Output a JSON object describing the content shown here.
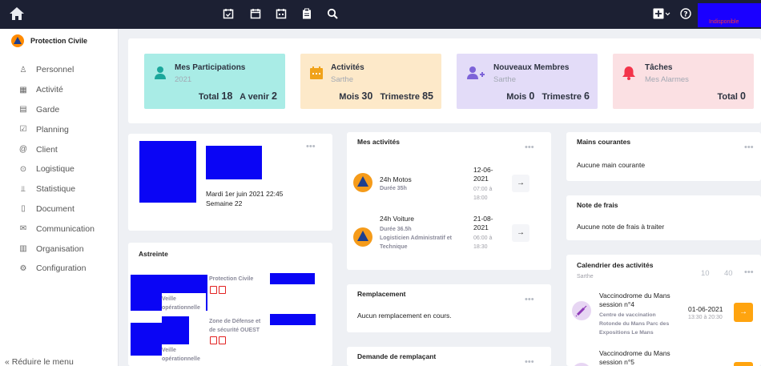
{
  "topbar": {
    "status_text": "Indisponible",
    "icons": [
      "home-icon",
      "calendar-check-icon",
      "calendar-blank-icon",
      "calendar-days-icon",
      "clipboard-icon",
      "search-icon",
      "add-square-icon",
      "help-circle-icon"
    ],
    "colors": {
      "bar": "#1c2033",
      "highlight": "#1a00ff",
      "status": "#ff3535"
    }
  },
  "sidebar": {
    "brand": "Protection Civile",
    "items": [
      {
        "label": "Personnel",
        "icon": "person-icon"
      },
      {
        "label": "Activité",
        "icon": "calendar-icon"
      },
      {
        "label": "Garde",
        "icon": "clipboard-icon"
      },
      {
        "label": "Planning",
        "icon": "calendar-check-icon"
      },
      {
        "label": "Client",
        "icon": "at-icon"
      },
      {
        "label": "Logistique",
        "icon": "target-icon"
      },
      {
        "label": "Statistique",
        "icon": "chart-icon"
      },
      {
        "label": "Document",
        "icon": "file-icon"
      },
      {
        "label": "Communication",
        "icon": "mail-icon"
      },
      {
        "label": "Organisation",
        "icon": "building-icon"
      },
      {
        "label": "Configuration",
        "icon": "gear-icon"
      }
    ],
    "collapse_label": "« Réduire le menu"
  },
  "stats": [
    {
      "title": "Mes Participations",
      "sub": "2021",
      "v1_label": "Total",
      "v1": "18",
      "v2_label": "A venir",
      "v2": "2",
      "bg": "#a9ece6",
      "icon": "user-icon",
      "icon_color": "#1ba79b"
    },
    {
      "title": "Activités",
      "sub": "Sarthe",
      "v1_label": "Mois",
      "v1": "30",
      "v2_label": "Trimestre",
      "v2": "85",
      "bg": "#fde9c9",
      "icon": "calendar-icon",
      "icon_color": "#f0a21a"
    },
    {
      "title": "Nouveaux Membres",
      "sub": "Sarthe",
      "v1_label": "Mois",
      "v1": "0",
      "v2_label": "Trimestre",
      "v2": "6",
      "bg": "#e3dcf8",
      "icon": "user-plus-icon",
      "icon_color": "#7d63d8"
    },
    {
      "title": "Tâches",
      "sub": "Mes Alarmes",
      "v1_label": "Total",
      "v1": "0",
      "v2_label": "",
      "v2": "",
      "bg": "#fbe0e3",
      "icon": "bell-icon",
      "icon_color": "#f3344a"
    }
  ],
  "profile": {
    "date": "Mardi 1er juin 2021 22:45",
    "week": "Semaine 22"
  },
  "astreinte": {
    "title": "Astreinte",
    "entries": [
      {
        "org": "Protection Civile",
        "role": "Veille",
        "role2": "opérationnelle"
      },
      {
        "org": "Zone de Défense et",
        "org2": "de sécurité OUEST",
        "role": "Veille",
        "role2": "opérationnelle"
      }
    ]
  },
  "mes_activites": {
    "title": "Mes activités",
    "items": [
      {
        "name": "24h Motos",
        "detail": "Durée 35h",
        "detail2": "",
        "date": "12-06-",
        "date2": "2021",
        "time": "07:00 à",
        "time2": "18:00"
      },
      {
        "name": "24h Voiture",
        "detail": "Durée 36.5h",
        "detail2": "Logisticien Administratif et",
        "detail3": "Technique",
        "date": "21-08-",
        "date2": "2021",
        "time": "06:00 à",
        "time2": "18:30"
      }
    ]
  },
  "remplacement": {
    "title": "Remplacement",
    "text": "Aucun remplacement en cours."
  },
  "demande": {
    "title": "Demande de remplaçant"
  },
  "mains": {
    "title": "Mains courantes",
    "text": "Aucune main courante"
  },
  "frais": {
    "title": "Note de frais",
    "text": "Aucune note de frais à traiter"
  },
  "calendrier": {
    "title": "Calendrier des activités",
    "sub": "Sarthe",
    "page_options": [
      "10",
      "40"
    ],
    "items": [
      {
        "title": "Vaccinodrome du Mans",
        "title2": "session n°4",
        "place": "Centre de vaccination",
        "place2": "Rotonde du Mans Parc des",
        "place3": "Expositions Le Mans",
        "date": "01-06-2021",
        "time": "13:30 à 20:30"
      },
      {
        "title": "Vaccinodrome du Mans",
        "title2": "session n°5"
      }
    ]
  }
}
